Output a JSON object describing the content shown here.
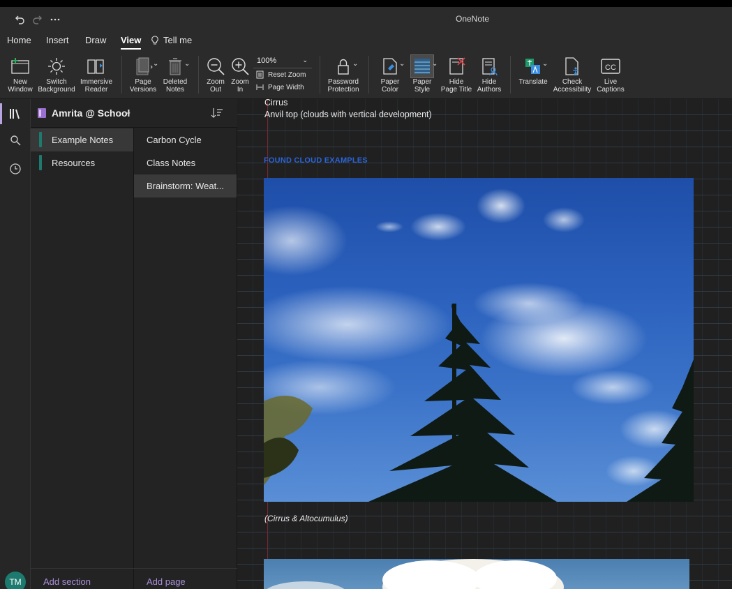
{
  "app": {
    "title": "OneNote"
  },
  "menu": {
    "tabs": [
      "Home",
      "Insert",
      "Draw",
      "View",
      "Tell me"
    ],
    "active": "View"
  },
  "ribbon": {
    "new_window": "New\nWindow",
    "switch_background": "Switch\nBackground",
    "immersive_reader": "Immersive\nReader",
    "page_versions": "Page\nVersions",
    "deleted_notes": "Deleted\nNotes",
    "zoom_out": "Zoom\nOut",
    "zoom_in": "Zoom\nIn",
    "zoom_value": "100%",
    "reset_zoom": "Reset Zoom",
    "page_width": "Page Width",
    "password_protection": "Password\nProtection",
    "paper_color": "Paper\nColor",
    "paper_style": "Paper\nStyle",
    "hide_page_title": "Hide\nPage Title",
    "hide_authors": "Hide\nAuthors",
    "translate": "Translate",
    "check_accessibility": "Check\nAccessibility",
    "live_captions": "Live\nCaptions"
  },
  "notebook": {
    "name": "Amrita @ School"
  },
  "sections": [
    {
      "label": "Example Notes",
      "selected": true
    },
    {
      "label": "Resources",
      "selected": false
    }
  ],
  "pages": [
    {
      "label": "Carbon Cycle",
      "selected": false
    },
    {
      "label": "Class Notes",
      "selected": false
    },
    {
      "label": "Brainstorm: Weat...",
      "selected": true
    }
  ],
  "footer": {
    "add_section": "Add section",
    "add_page": "Add page",
    "avatar_initials": "TM"
  },
  "note": {
    "line1": "Cirrus",
    "line2": "Anvil top  (clouds with vertical development)",
    "heading": "FOUND CLOUD EXAMPLES",
    "caption": "(Cirrus & Altocumulus)"
  },
  "colors": {
    "accent": "#b8a4e0",
    "section_tab": "#1d7a6e",
    "heading_blue": "#2a64d8",
    "margin_red": "#7a2730"
  }
}
